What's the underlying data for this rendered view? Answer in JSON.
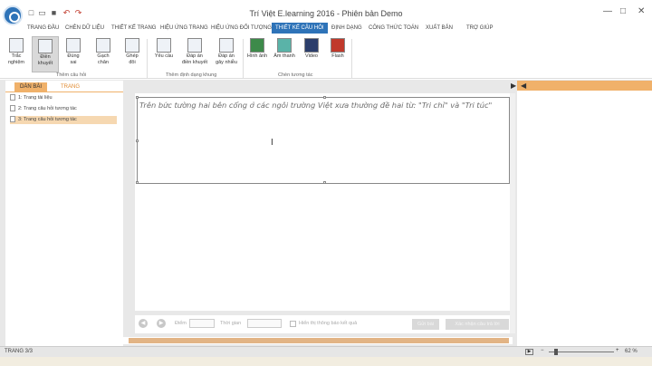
{
  "window": {
    "title": "Trí Việt E.learning 2016 - Phiên bản Demo"
  },
  "ribbon_tabs": [
    "TRANG ĐẦU",
    "CHÈN DỮ LIỆU",
    "THIẾT KẾ TRANG",
    "HIỆU ỨNG TRANG",
    "HIỆU ỨNG ĐỐI TƯỢNG",
    "THIẾT KẾ CÂU HỎI",
    "ĐỊNH DẠNG",
    "CÔNG THỨC TOÁN",
    "XUẤT BẢN",
    "TRỢ GIÚP"
  ],
  "ribbon": {
    "buttons": [
      {
        "l1": "Trắc",
        "l2": "nghiệm"
      },
      {
        "l1": "Điền",
        "l2": "khuyết"
      },
      {
        "l1": "Đúng",
        "l2": "sai"
      },
      {
        "l1": "Gạch",
        "l2": "chân"
      },
      {
        "l1": "Ghép",
        "l2": "đôi"
      },
      {
        "l1": "Yêu cầu",
        "l2": ""
      },
      {
        "l1": "Đáp án",
        "l2": "điền khuyết"
      },
      {
        "l1": "Đáp án",
        "l2": "gây nhiễu"
      },
      {
        "l1": "Hình ảnh",
        "l2": ""
      },
      {
        "l1": "Âm thanh",
        "l2": ""
      },
      {
        "l1": "Video",
        "l2": ""
      },
      {
        "l1": "Flash",
        "l2": ""
      }
    ],
    "groups": [
      "Thêm câu hỏi",
      "Thêm định dạng khung",
      "Chèn tương tác"
    ]
  },
  "left_panel": {
    "tabs": [
      "DÀN BÀI",
      "TRANG"
    ],
    "items": [
      "1: Trang tài liệu",
      "2: Trang câu hỏi tương tác",
      "3: Trang câu hỏi tương tác"
    ]
  },
  "slide": {
    "text": "Trên bức tường hai bên cổng ở các ngôi trường Việt xưa thường đề hai từ: \"Tri chỉ\" và \"Tri túc\""
  },
  "bottom_bar": {
    "score_label": "Điểm",
    "time_label": "Thời gian",
    "show_result": "Hiển thị thông báo kết quả",
    "submit": "Gửi bài",
    "reset": "Xác nhận câu trả lời"
  },
  "status": {
    "page": "TRANG 3/3",
    "zoom": "62 %"
  }
}
